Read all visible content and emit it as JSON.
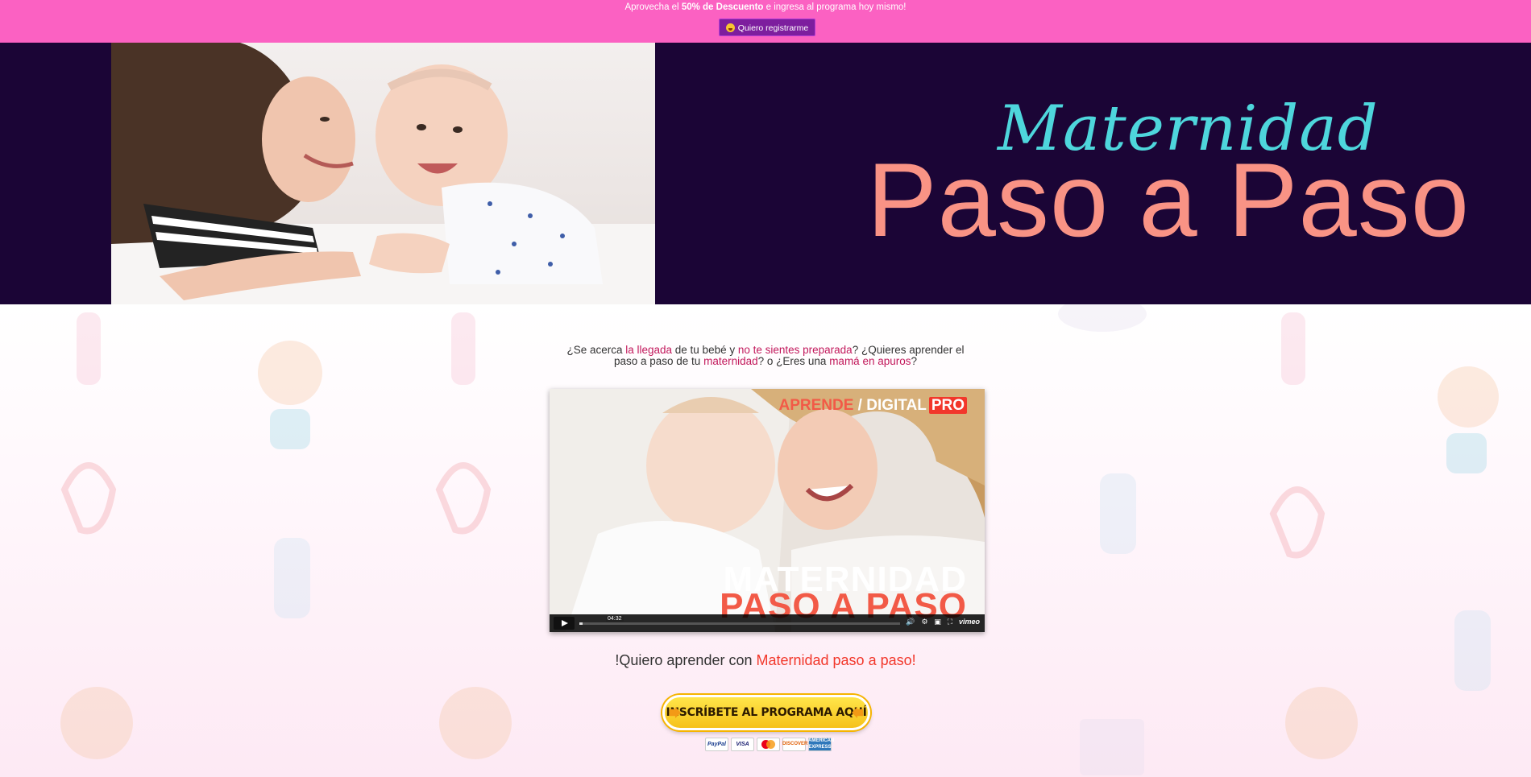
{
  "topbar": {
    "promo_prefix": "Aprovecha el ",
    "promo_bold": "50% de Descuento",
    "promo_suffix": " e ingresa al programa hoy mismo!",
    "cta_label": "Quiero registrarme",
    "cta_icon": "smiley-emoji-icon"
  },
  "hero": {
    "script_title": "Maternidad",
    "main_title": "Paso a Paso",
    "image": "mother-and-baby-photo"
  },
  "intro": {
    "t1": "¿Se acerca ",
    "h1": "la llegada",
    "t2": " de tu bebé y ",
    "h2": "no te sientes preparada",
    "t3": "? ¿Quieres aprender el paso a paso de tu ",
    "h3": "maternidad",
    "t4": "? o ¿Eres una ",
    "h4": "mamá en apuros",
    "t5": "?"
  },
  "video": {
    "brand_a": "APRENDE",
    "brand_sep": " / ",
    "brand_d": "DIGITAL",
    "brand_pro": "PRO",
    "title_line1": "MATERNIDAD",
    "title_line2": "PASO A PASO",
    "timecode": "04:32",
    "player_brand": "vimeo",
    "progress": 0.01
  },
  "learn": {
    "prefix": "!Quiero aprender con ",
    "highlight": "Maternidad paso a paso!"
  },
  "enroll": {
    "label": "INSCRÍBETE AL PROGRAMA AQUÍ"
  },
  "payments": [
    "PayPal",
    "VISA",
    "MasterCard",
    "DISCOVER",
    "AMERICAN EXPRESS"
  ],
  "colors": {
    "topbar": "#fb61c2",
    "hero_bg": "#1b0536",
    "script_title": "#4ed6dc",
    "main_title": "#f99385",
    "highlight": "#c2185b",
    "cta_bg": "#7d1e9e"
  }
}
